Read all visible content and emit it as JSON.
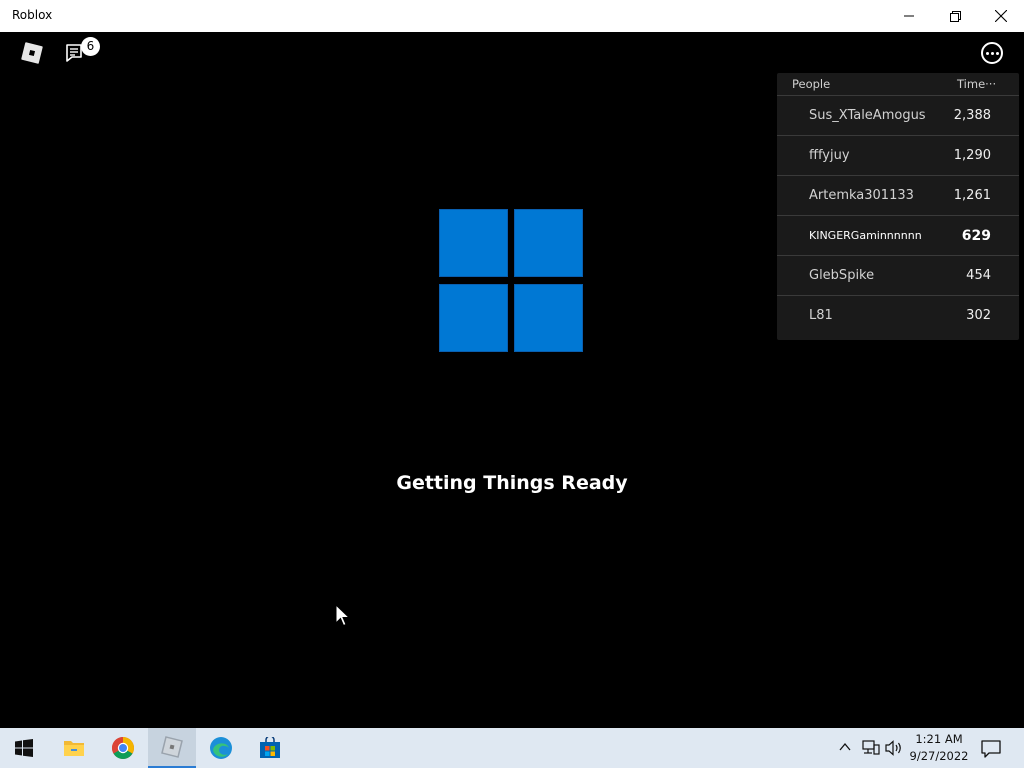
{
  "window": {
    "title": "Roblox"
  },
  "hud": {
    "chat_badge_count": "6"
  },
  "loading": {
    "status_text": "Getting Things Ready",
    "logo_color": "#0078d4"
  },
  "leaderboard": {
    "col_people": "People",
    "col_time": "Time···",
    "rows": [
      {
        "name": "Sus_XTaleAmogus",
        "value": "2,388"
      },
      {
        "name": "fffyjuy",
        "value": "1,290"
      },
      {
        "name": "Artemka301133",
        "value": "1,261"
      },
      {
        "name": "KINGERGaminnnnnn",
        "value": "629"
      },
      {
        "name": "GlebSpike",
        "value": "454"
      },
      {
        "name": "L81",
        "value": "302"
      }
    ]
  },
  "taskbar": {
    "apps": [
      "start-icon",
      "file-explorer-icon",
      "chrome-icon",
      "roblox-icon",
      "edge-icon",
      "microsoft-store-icon"
    ],
    "active_app": "Roblox",
    "clock_time": "1:21 AM",
    "clock_date": "9/27/2022"
  }
}
